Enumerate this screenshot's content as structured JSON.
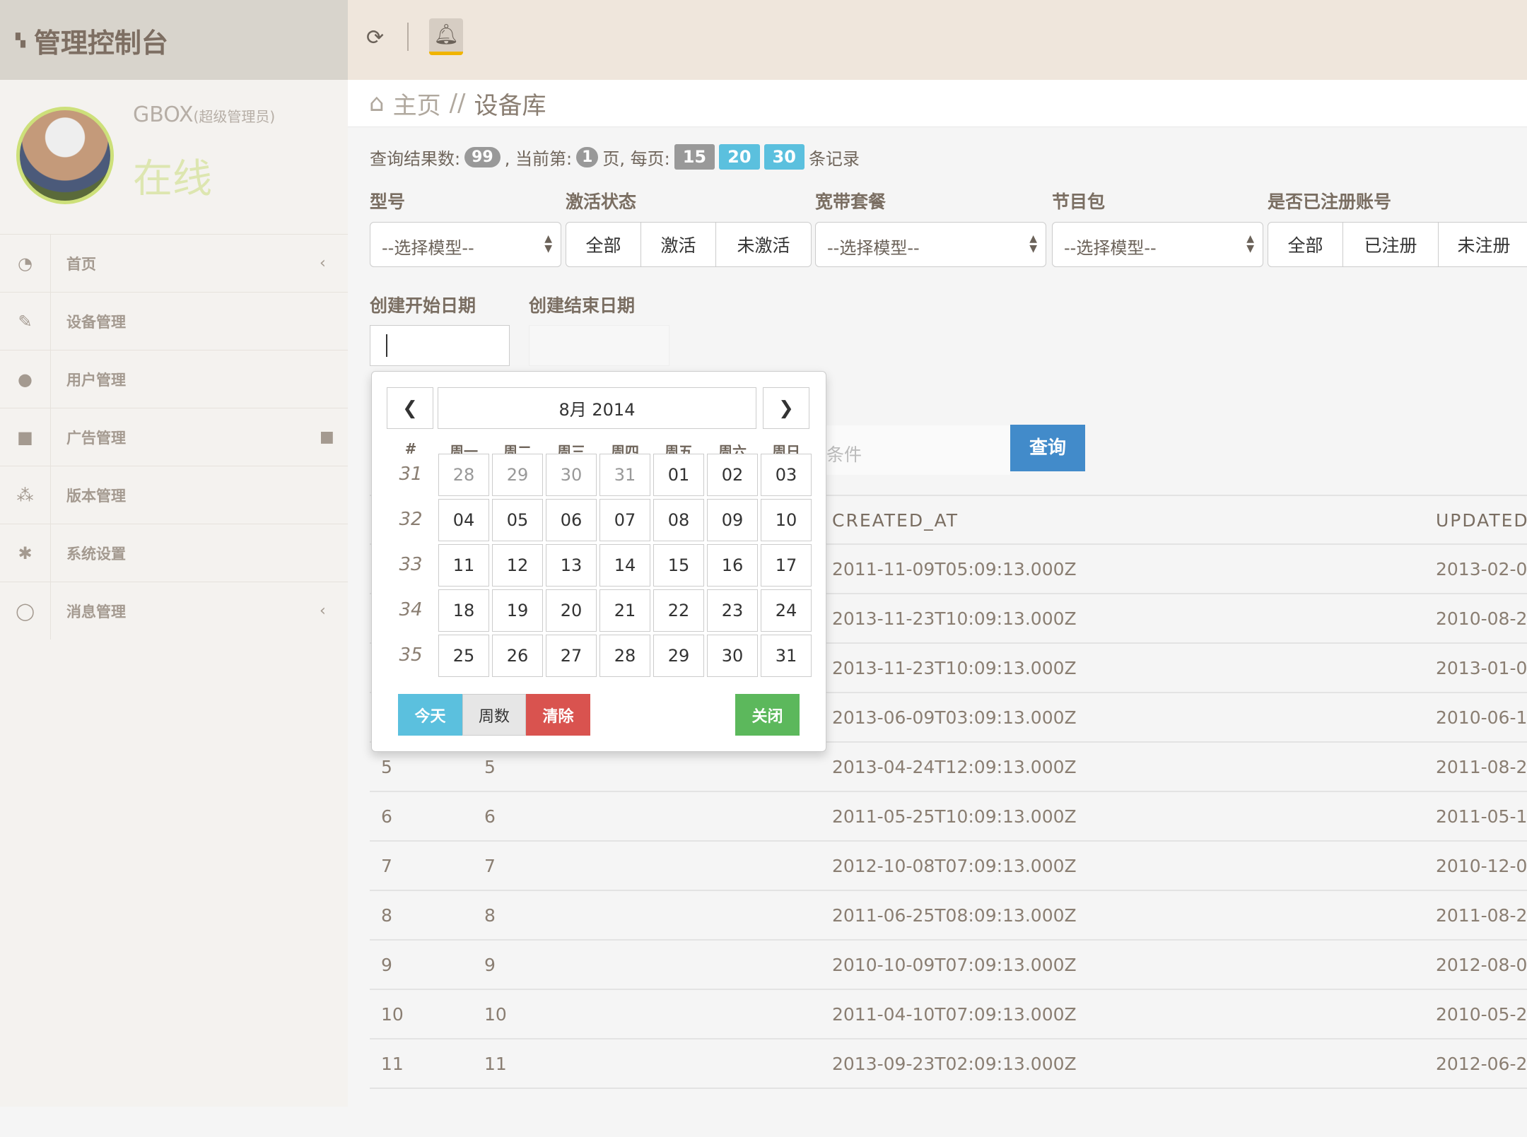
{
  "header": {
    "title": "管理控制台",
    "refresh_icon": "refresh-icon",
    "bell_icon": "bell-icon",
    "accent": "#f0b400"
  },
  "profile": {
    "name": "GBOX",
    "role": "(超级管理员)",
    "status": "在线"
  },
  "sidebar": {
    "items": [
      {
        "label": "首页",
        "icon": "dashboard-icon",
        "glyph": "◔",
        "arrow": "‹"
      },
      {
        "label": "设备管理",
        "icon": "pencil-icon",
        "glyph": "✎",
        "arrow": ""
      },
      {
        "label": "用户管理",
        "icon": "user-icon",
        "glyph": "●",
        "arrow": ""
      },
      {
        "label": "广告管理",
        "icon": "video-camera-icon",
        "glyph": "■",
        "arrow": "■"
      },
      {
        "label": "版本管理",
        "icon": "users-icon",
        "glyph": "⁂",
        "arrow": ""
      },
      {
        "label": "系统设置",
        "icon": "asterisk-icon",
        "glyph": "✱",
        "arrow": ""
      },
      {
        "label": "消息管理",
        "icon": "comment-icon",
        "glyph": "◯",
        "arrow": "‹"
      }
    ]
  },
  "breadcrumb": {
    "home": "主页",
    "sep": "//",
    "current": "设备库"
  },
  "query": {
    "prefix": "查询结果数:",
    "count": "99",
    "current_label": ", 当前第:",
    "page": "1",
    "page_suffix": "页, 每页:",
    "sizes": [
      "15",
      "20",
      "30"
    ],
    "suffix": "条记录",
    "colors": {
      "active": "#999999",
      "size": "#5bc0de"
    }
  },
  "filters": {
    "model": {
      "label": "型号",
      "value": "--选择模型--"
    },
    "activation": {
      "label": "激活状态",
      "options": [
        "全部",
        "激活",
        "未激活"
      ]
    },
    "broadband": {
      "label": "宽带套餐",
      "value": "--选择模型--"
    },
    "package": {
      "label": "节目包",
      "value": "--选择模型--"
    },
    "registered": {
      "label": "是否已注册账号",
      "options": [
        "全部",
        "已注册",
        "未注册"
      ]
    },
    "start_date": {
      "label": "创建开始日期",
      "value": ""
    },
    "end_date": {
      "label": "创建结束日期",
      "value": ""
    },
    "search_placeholder": "条件",
    "search_button": "查询"
  },
  "calendar": {
    "title": "8月 2014",
    "headers": [
      "#",
      "周一",
      "周二",
      "周三",
      "周四",
      "周五",
      "周六",
      "周日"
    ],
    "weeks": [
      {
        "num": "31",
        "days": [
          "28",
          "29",
          "30",
          "31",
          "01",
          "02",
          "03"
        ],
        "old": 4
      },
      {
        "num": "32",
        "days": [
          "04",
          "05",
          "06",
          "07",
          "08",
          "09",
          "10"
        ],
        "old": 0
      },
      {
        "num": "33",
        "days": [
          "11",
          "12",
          "13",
          "14",
          "15",
          "16",
          "17"
        ],
        "old": 0
      },
      {
        "num": "34",
        "days": [
          "18",
          "19",
          "20",
          "21",
          "22",
          "23",
          "24"
        ],
        "old": 0
      },
      {
        "num": "35",
        "days": [
          "25",
          "26",
          "27",
          "28",
          "29",
          "30",
          "31"
        ],
        "old": 0
      }
    ],
    "today": "今天",
    "weeks_btn": "周数",
    "clear": "清除",
    "close": "关闭"
  },
  "table": {
    "headers": [
      "",
      "",
      "CREATED_AT",
      "UPDATED"
    ],
    "rows": [
      [
        "",
        "",
        "2011-11-09T05:09:13.000Z",
        "2013-02-0"
      ],
      [
        "",
        "",
        "2013-11-23T10:09:13.000Z",
        "2010-08-2"
      ],
      [
        "",
        "",
        "2013-11-23T10:09:13.000Z",
        "2013-01-0"
      ],
      [
        "",
        "",
        "2013-06-09T03:09:13.000Z",
        "2010-06-1"
      ],
      [
        "5",
        "5",
        "2013-04-24T12:09:13.000Z",
        "2011-08-2"
      ],
      [
        "6",
        "6",
        "2011-05-25T10:09:13.000Z",
        "2011-05-1"
      ],
      [
        "7",
        "7",
        "2012-10-08T07:09:13.000Z",
        "2010-12-0"
      ],
      [
        "8",
        "8",
        "2011-06-25T08:09:13.000Z",
        "2011-08-2"
      ],
      [
        "9",
        "9",
        "2010-10-09T07:09:13.000Z",
        "2012-08-0"
      ],
      [
        "10",
        "10",
        "2011-04-10T07:09:13.000Z",
        "2010-05-2"
      ],
      [
        "11",
        "11",
        "2013-09-23T02:09:13.000Z",
        "2012-06-2"
      ]
    ]
  }
}
